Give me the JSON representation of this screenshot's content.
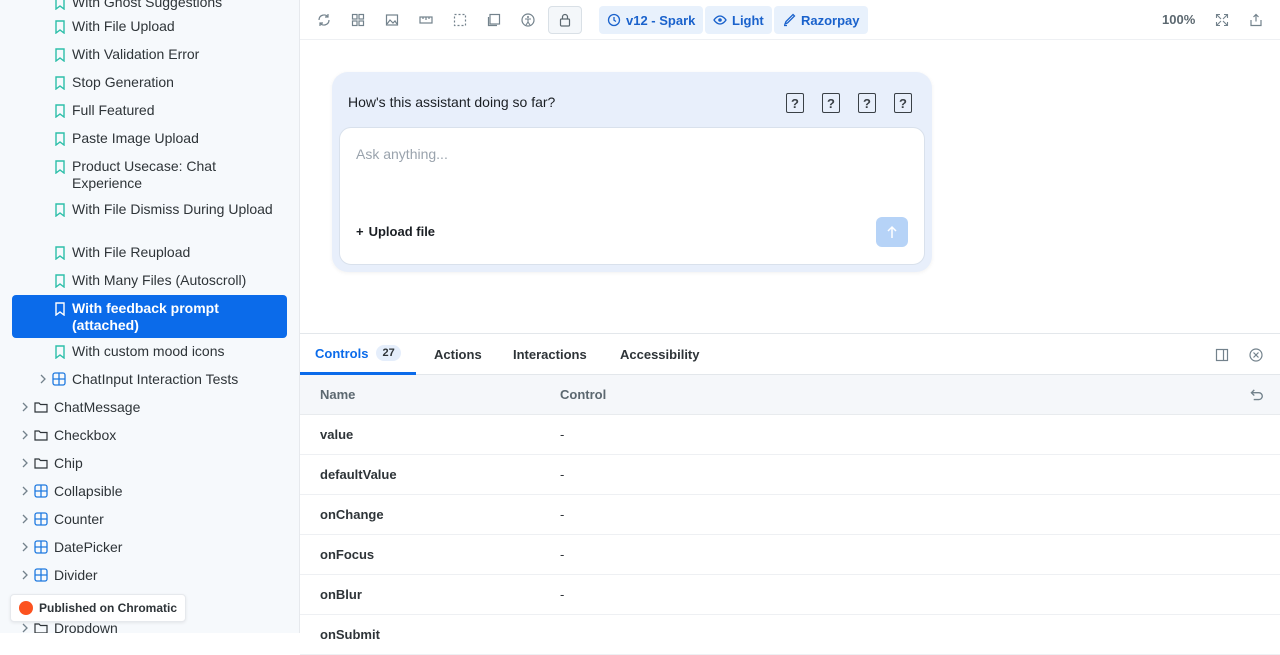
{
  "sidebar": {
    "story_items": [
      {
        "label": "With Ghost Suggestions",
        "active": false
      },
      {
        "label": "With File Upload",
        "active": false
      },
      {
        "label": "With Validation Error",
        "active": false
      },
      {
        "label": "Stop Generation",
        "active": false
      },
      {
        "label": "Full Featured",
        "active": false
      },
      {
        "label": "Paste Image Upload",
        "active": false
      },
      {
        "label": "Product Usecase: Chat Experience",
        "active": false
      },
      {
        "label": "With File Dismiss During Upload",
        "active": false
      },
      {
        "label": "With File Reupload",
        "active": false
      },
      {
        "label": "With Many Files (Autoscroll)",
        "active": false
      },
      {
        "label": "With feedback prompt (attached)",
        "active": true
      },
      {
        "label": "With custom mood icons",
        "active": false
      }
    ],
    "nested_component": {
      "label": "ChatInput Interaction Tests",
      "icon": "component-icon"
    },
    "components": [
      {
        "label": "ChatMessage",
        "icon": "folder-icon"
      },
      {
        "label": "Checkbox",
        "icon": "folder-icon"
      },
      {
        "label": "Chip",
        "icon": "folder-icon"
      },
      {
        "label": "Collapsible",
        "icon": "component-icon"
      },
      {
        "label": "Counter",
        "icon": "component-icon"
      },
      {
        "label": "DatePicker",
        "icon": "component-icon"
      },
      {
        "label": "Divider",
        "icon": "component-icon"
      },
      {
        "label": "Dropdown",
        "icon": "folder-icon"
      }
    ],
    "chromatic_badge": "Published on Chromatic"
  },
  "toolbar": {
    "icons": [
      "reload-icon",
      "grid-icon",
      "image-icon",
      "ruler-icon",
      "outline-icon",
      "viewport-icon",
      "accessibility-icon",
      "lock-icon"
    ],
    "version_label": "v12 - Spark",
    "theme_label": "Light",
    "brand_label": "Razorpay",
    "zoom": "100%"
  },
  "canvas": {
    "feedback_prompt": "How's this assistant doing so far?",
    "mood_icons": [
      "?",
      "?",
      "?",
      "?"
    ],
    "input_placeholder": "Ask anything...",
    "upload_label": "Upload file"
  },
  "addons": {
    "tabs": [
      {
        "label": "Controls",
        "count": "27",
        "active": true
      },
      {
        "label": "Actions",
        "active": false
      },
      {
        "label": "Interactions",
        "active": false
      },
      {
        "label": "Accessibility",
        "active": false
      }
    ],
    "table": {
      "headers": {
        "name": "Name",
        "control": "Control"
      },
      "rows": [
        {
          "name": "value",
          "control": "-"
        },
        {
          "name": "defaultValue",
          "control": "-"
        },
        {
          "name": "onChange",
          "control": "-"
        },
        {
          "name": "onFocus",
          "control": "-"
        },
        {
          "name": "onBlur",
          "control": "-"
        },
        {
          "name": "onSubmit",
          "control": ""
        }
      ]
    }
  },
  "colors": {
    "accent": "#0b6bea",
    "pill_bg": "#e8f1fc",
    "card_bg": "#e8effb",
    "chromatic": "#fc521f"
  }
}
